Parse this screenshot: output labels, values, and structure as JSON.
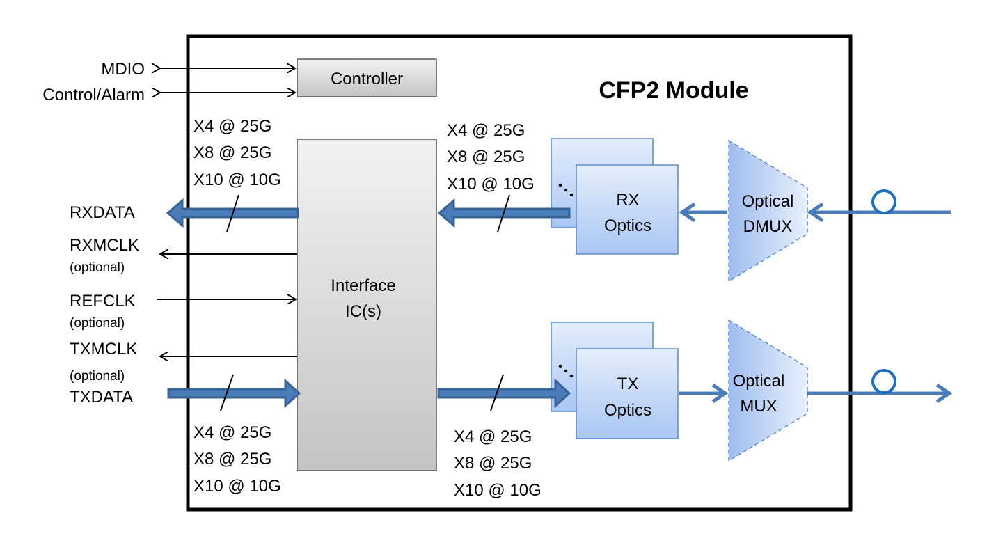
{
  "module": {
    "title": "CFP2 Module"
  },
  "controller": {
    "label": "Controller"
  },
  "interface_ic": {
    "line1": "Interface",
    "line2": "IC(s)"
  },
  "signals": {
    "mdio": "MDIO",
    "control_alarm": "Control/Alarm",
    "rxdata": "RXDATA",
    "rxmclk": "RXMCLK",
    "refclk": "REFCLK",
    "txmclk": "TXMCLK",
    "txdata": "TXDATA",
    "optional": "(optional)"
  },
  "lane_configs": [
    "X4 @ 25G",
    "X8 @ 25G",
    "X10 @ 10G"
  ],
  "rx_optics": {
    "line1": "RX",
    "line2": "Optics"
  },
  "tx_optics": {
    "line1": "TX",
    "line2": "Optics"
  },
  "dmux": {
    "line1": "Optical",
    "line2": "DMUX"
  },
  "mux": {
    "line1": "Optical",
    "line2": "MUX"
  },
  "colors": {
    "data_bus": "#4a7cba",
    "optics_fill": "#b8d0f5",
    "ic_fill": "#d6d6d6"
  }
}
